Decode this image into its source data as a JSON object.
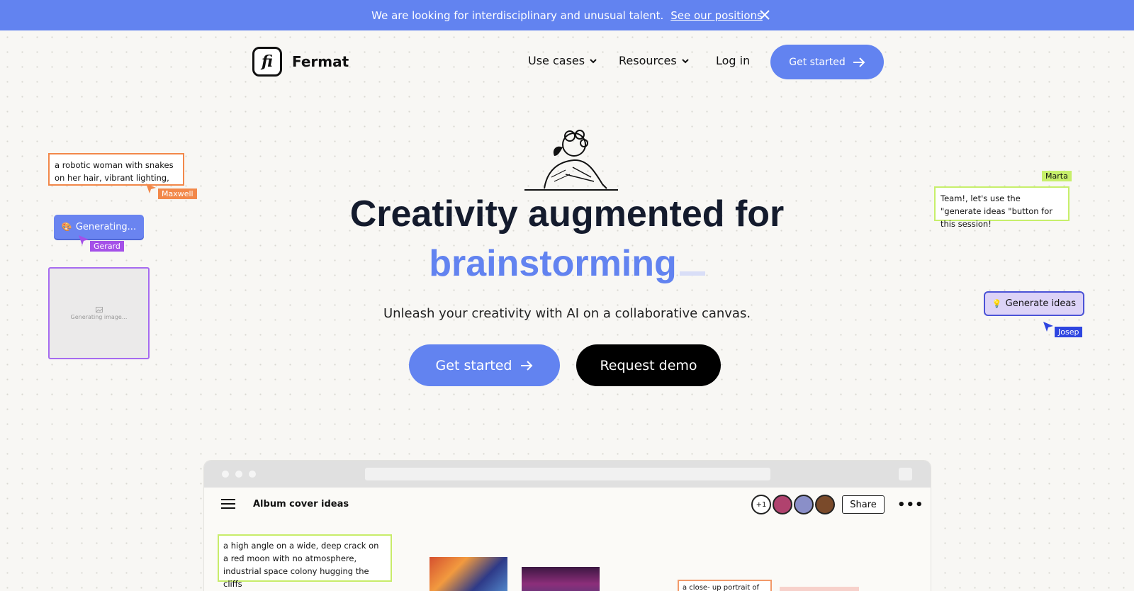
{
  "banner": {
    "text": "We are looking for interdisciplinary and unusual talent.",
    "link": "See our positions"
  },
  "logo": {
    "mark": "fi",
    "name": "Fermat"
  },
  "nav": {
    "use_cases": "Use cases",
    "resources": "Resources",
    "login": "Log in",
    "get_started": "Get started"
  },
  "hero": {
    "headline": "Creativity augmented for",
    "highlight": "brainstorming",
    "subtitle": "Unleash your creativity with AI on a collaborative canvas.",
    "primary_cta": "Get started",
    "secondary_cta": "Request demo"
  },
  "canvas": {
    "prompt_note": "a robotic woman with snakes on her hair, vibrant lighting,",
    "maxwell": "Maxwell",
    "generating": "Generating...",
    "gerard": "Gerard",
    "generating_image": "Generating image...",
    "marta": "Marta",
    "team_note": "Team!, let's use the \"generate ideas \"button for this session!",
    "generate_ideas": "Generate ideas",
    "josep": "Josep"
  },
  "mockup": {
    "title": "Album cover ideas",
    "avatar_more": "+1",
    "share": "Share",
    "more": "•••",
    "note": "a high angle on a wide, deep crack on a red moon with no atmosphere, industrial space colony hugging the cliffs",
    "note2": "a close- up portrait of"
  },
  "colors": {
    "accent": "#6283f0",
    "maxwell": "#f2884a",
    "gerard": "#a450e8",
    "marta": "#c7ef6b",
    "josep": "#2e45e0"
  }
}
